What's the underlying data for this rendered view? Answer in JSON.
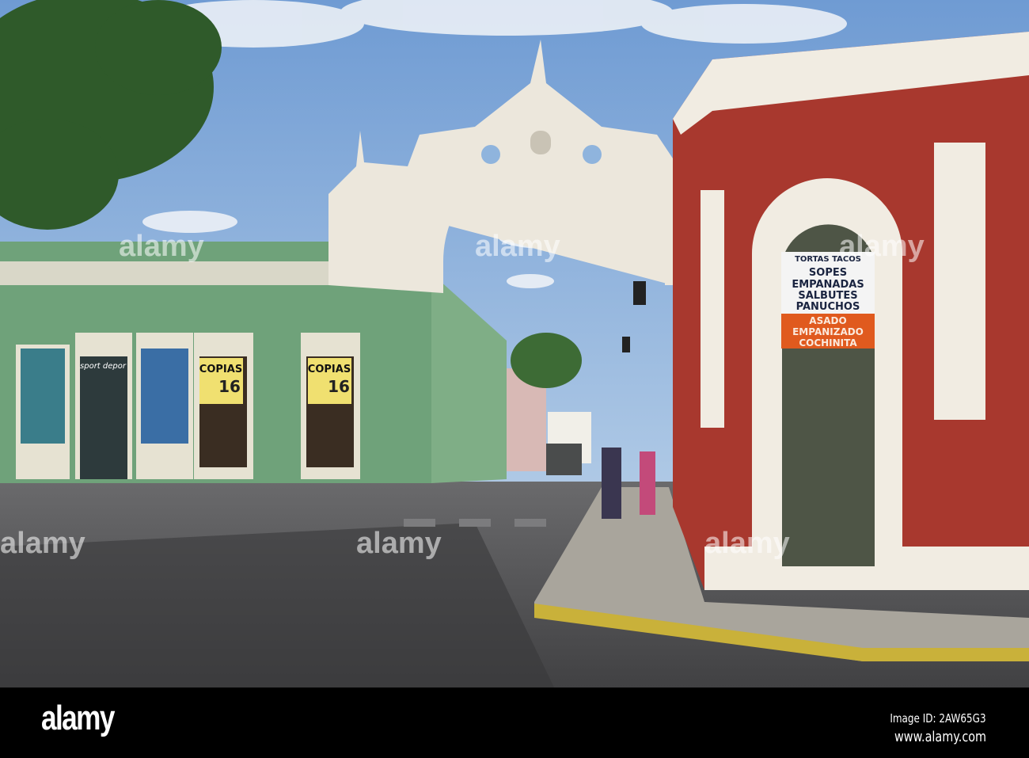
{
  "photo": {
    "description_colors": {
      "sky": "#8fb4dd",
      "green_building": "#6fa27a",
      "red_building": "#a8382e",
      "arch": "#ece7dc",
      "road": "#5a5a5c"
    },
    "shop_signs": {
      "left_copias": "COPIAS",
      "right_copias": "COPIAS",
      "price": "16",
      "sport": "sport depor"
    },
    "food_sign": {
      "top_line": "TORTAS TACOS",
      "white_lines": [
        "SOPES",
        "EMPANADAS",
        "SALBUTES",
        "PANUCHOS"
      ],
      "orange_lines": [
        "ASADO",
        "EMPANIZADO",
        "COCHINITA"
      ]
    }
  },
  "watermark": {
    "text": "alamy"
  },
  "footer": {
    "logo": "alamy",
    "image_id": "Image ID: 2AW65G3",
    "website": "www.alamy.com"
  }
}
